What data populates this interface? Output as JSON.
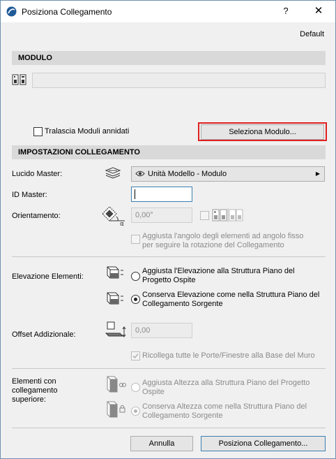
{
  "window": {
    "title": "Posiziona Collegamento",
    "help": "?",
    "close": "✕",
    "preset": "Default"
  },
  "module_section": {
    "header": "MODULO",
    "path_value": "",
    "skip_nested_label": "Tralascia Moduli annidati",
    "select_button": "Seleziona Modulo..."
  },
  "settings_section": {
    "header": "IMPOSTAZIONI COLLEGAMENTO",
    "master_layer_label": "Lucido Master:",
    "master_layer_value": "Unità Modello - Modulo",
    "master_id_label": "ID Master:",
    "master_id_value": "",
    "orientation_label": "Orientamento:",
    "orientation_value": "0,00°",
    "adjust_angle_label_1": "Aggiusta l'angolo degli elementi ad angolo fisso",
    "adjust_angle_label_2": "per seguire la rotazione del Collegamento",
    "elevation_label": "Elevazione Elementi:",
    "elev_option1_line1": "Aggiusta l'Elevazione alla Struttura Piano del",
    "elev_option1_line2": "Progetto Ospite",
    "elev_option2_line1": "Conserva Elevazione come nella Struttura Piano del",
    "elev_option2_line2": "Collegamento Sorgente",
    "offset_label": "Offset Addizionale:",
    "offset_value": "0,00",
    "relink_label": "Ricollega tutte le Porte/Finestre alla Base del Muro",
    "top_linked_label_1": "Elementi con",
    "top_linked_label_2": "collegamento",
    "top_linked_label_3": "superiore:",
    "height_option1_line1": "Aggiusta Altezza alla Struttura Piano del Progetto",
    "height_option1_line2": "Ospite",
    "height_option2_line1": "Conserva Altezza come nella Struttura Piano del",
    "height_option2_line2": "Collegamento Sorgente"
  },
  "footer": {
    "cancel": "Annulla",
    "place": "Posiziona Collegamento..."
  }
}
